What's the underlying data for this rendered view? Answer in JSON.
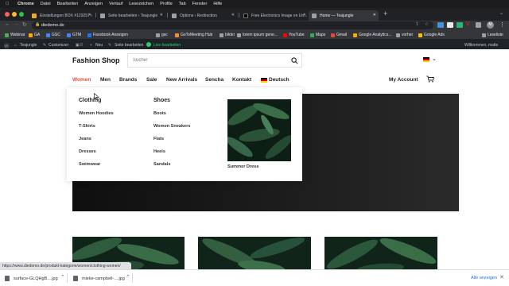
{
  "menubar": {
    "app": "Chrome",
    "items": [
      "Datei",
      "Bearbeiten",
      "Anzeigen",
      "Verlauf",
      "Lesezeichen",
      "Profile",
      "Tab",
      "Fenster",
      "Hilfe"
    ]
  },
  "tabs": [
    {
      "label": "Einstellungen BOX #129257 ›"
    },
    {
      "label": "Seite bearbeiten ‹ Teajungle"
    },
    {
      "label": "Options ‹ Redirection"
    },
    {
      "label": "Free Electronics Image on Un..."
    },
    {
      "label": "Home — Teajungle"
    }
  ],
  "address": {
    "url": "diedemo.de"
  },
  "bookmarks": [
    "Webinar",
    "GA",
    "GSC",
    "GTM",
    "Facebook Anzeigen",
    "gsc",
    "GoToMeeting Hub",
    "bilder",
    "lorem ipsum gene...",
    "YouTube",
    "Maps",
    "Gmail",
    "Google Analytics...",
    "vorher",
    "Google Ads"
  ],
  "bookmarks_right": "Leseliste",
  "adminbar": {
    "site": "Teajungle",
    "customize": "Customizer",
    "new": "Neu",
    "edit": "Seite bearbeiten",
    "live": "Live bearbeiten",
    "greeting": "Willkommen, malte"
  },
  "site": {
    "logo": "Fashion Shop",
    "search_placeholder": "Suche!",
    "nav": [
      "Women",
      "Men",
      "Brands",
      "Sale",
      "New Arrivals",
      "Sencha",
      "Kontakt",
      "Deutsch"
    ],
    "account": "My Account"
  },
  "mega": {
    "col1_title": "Clothing",
    "col1_items": [
      "Women Hoodies",
      "T-Shirts",
      "Jeans",
      "Dresses",
      "Swimwear"
    ],
    "col2_title": "Shoes",
    "col2_items": [
      "Boots",
      "Women Sneakers",
      "Flats",
      "Heels",
      "Sandals"
    ],
    "feature_caption": "Summer Dress"
  },
  "status": {
    "url": "https://www.diedemo.de/produkt-kategorie/women/clothing-women/"
  },
  "downloads": {
    "items": [
      "surface-GLQHgB....jpg",
      "mieke-campbell-....jpg"
    ],
    "show_all": "Alle anzeigen"
  },
  "colors": {
    "accent": "#e0503d",
    "admin_bg": "#1d2327",
    "live": "#2ecc71"
  },
  "icons": [
    "apple-icon",
    "search-icon",
    "cart-icon",
    "flag-de-icon",
    "wordpress-icon"
  ]
}
